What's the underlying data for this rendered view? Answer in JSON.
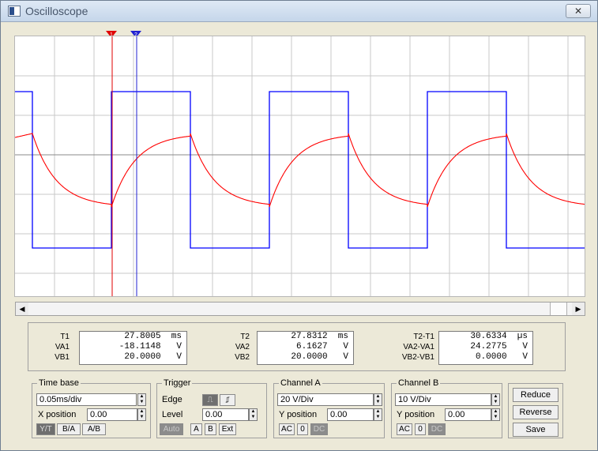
{
  "window": {
    "title": "Oscilloscope",
    "close_glyph": "✕"
  },
  "cursors": {
    "t1_marker": "1",
    "t2_marker": "2"
  },
  "measurements": {
    "t1": {
      "label": "T1",
      "value": "27.8005  ms"
    },
    "va1": {
      "label": "VA1",
      "value": "-18.1148   V"
    },
    "vb1": {
      "label": "VB1",
      "value": "20.0000   V"
    },
    "t2": {
      "label": "T2",
      "value": "27.8312  ms"
    },
    "va2": {
      "label": "VA2",
      "value": "6.1627   V"
    },
    "vb2": {
      "label": "VB2",
      "value": "20.0000   V"
    },
    "dt": {
      "label": "T2-T1",
      "value": "30.6334  µs"
    },
    "dva": {
      "label": "VA2-VA1",
      "value": "24.2775   V"
    },
    "dvb": {
      "label": "VB2-VB1",
      "value": "0.0000   V"
    }
  },
  "timebase": {
    "title": "Time base",
    "scale": "0.05ms/div",
    "xpos_label": "X position",
    "xpos": "0.00",
    "modes": [
      "Y/T",
      "B/A",
      "A/B"
    ]
  },
  "trigger": {
    "title": "Trigger",
    "edge_label": "Edge",
    "edge_rise": "⎍",
    "edge_fall": "⎎",
    "level_label": "Level",
    "level": "0.00",
    "sources": [
      "Auto",
      "A",
      "B",
      "Ext"
    ]
  },
  "channel_a": {
    "title": "Channel A",
    "scale": "20  V/Div",
    "ypos_label": "Y position",
    "ypos": "0.00",
    "coupling": [
      "AC",
      "0",
      "DC"
    ]
  },
  "channel_b": {
    "title": "Channel B",
    "scale": "10  V/Div",
    "ypos_label": "Y position",
    "ypos": "0.00",
    "coupling": [
      "AC",
      "0",
      "DC"
    ]
  },
  "actions": {
    "reduce": "Reduce",
    "reverse": "Reverse",
    "save": "Save"
  },
  "colors": {
    "channel_a": "#ff0000",
    "channel_b": "#0000ff",
    "grid": "#c8c8c8"
  }
}
